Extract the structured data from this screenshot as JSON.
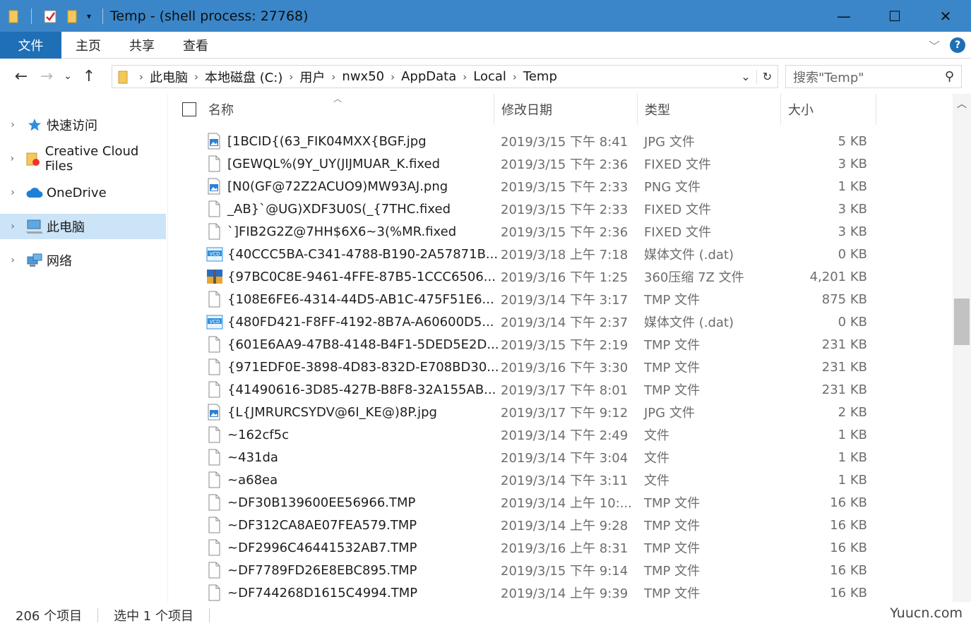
{
  "window": {
    "title": "Temp - (shell process: 27768)",
    "minimize": "—",
    "maximize": "☐",
    "close": "✕"
  },
  "ribbon": {
    "tabs": [
      "文件",
      "主页",
      "共享",
      "查看"
    ]
  },
  "address": {
    "crumbs": [
      "此电脑",
      "本地磁盘 (C:)",
      "用户",
      "nwx50",
      "AppData",
      "Local",
      "Temp"
    ],
    "search_placeholder": "搜索\"Temp\""
  },
  "sidebar": {
    "items": [
      {
        "label": "快速访问",
        "icon": "star-icon"
      },
      {
        "label": "Creative Cloud Files",
        "icon": "folder-cc-icon"
      },
      {
        "label": "OneDrive",
        "icon": "cloud-icon"
      },
      {
        "label": "此电脑",
        "icon": "computer-icon",
        "selected": true
      },
      {
        "label": "网络",
        "icon": "network-icon"
      }
    ]
  },
  "columns": {
    "name": "名称",
    "date": "修改日期",
    "type": "类型",
    "size": "大小"
  },
  "files": [
    {
      "name": "[1BCID{(63_FIK04MXX{BGF.jpg",
      "date": "2019/3/15 下午 8:41",
      "type": "JPG 文件",
      "size": "5 KB",
      "icon": "image"
    },
    {
      "name": "[GEWQL%(9Y_UY(JIJMUAR_K.fixed",
      "date": "2019/3/15 下午 2:36",
      "type": "FIXED 文件",
      "size": "3 KB",
      "icon": "file"
    },
    {
      "name": "[N0(GF@72Z2ACUO9)MW93AJ.png",
      "date": "2019/3/15 下午 2:33",
      "type": "PNG 文件",
      "size": "1 KB",
      "icon": "image"
    },
    {
      "name": "_AB}`@UG)XDF3U0S(_{7THC.fixed",
      "date": "2019/3/15 下午 2:33",
      "type": "FIXED 文件",
      "size": "3 KB",
      "icon": "file"
    },
    {
      "name": "`]FIB2G2Z@7HH$6X6~3(%MR.fixed",
      "date": "2019/3/15 下午 2:36",
      "type": "FIXED 文件",
      "size": "3 KB",
      "icon": "file"
    },
    {
      "name": "{40CCC5BA-C341-4788-B190-2A57871B...",
      "date": "2019/3/18 上午 7:18",
      "type": "媒体文件 (.dat)",
      "size": "0 KB",
      "icon": "vcd"
    },
    {
      "name": "{97BC0C8E-9461-4FFE-87B5-1CCC6506...",
      "date": "2019/3/16 下午 1:25",
      "type": "360压缩 7Z 文件",
      "size": "4,201 KB",
      "icon": "archive"
    },
    {
      "name": "{108E6FE6-4314-44D5-AB1C-475F51E6...",
      "date": "2019/3/14 下午 3:17",
      "type": "TMP 文件",
      "size": "875 KB",
      "icon": "file"
    },
    {
      "name": "{480FD421-F8FF-4192-8B7A-A60600D5...",
      "date": "2019/3/14 下午 2:37",
      "type": "媒体文件 (.dat)",
      "size": "0 KB",
      "icon": "vcd"
    },
    {
      "name": "{601E6AA9-47B8-4148-B4F1-5DED5E2D...",
      "date": "2019/3/15 下午 2:19",
      "type": "TMP 文件",
      "size": "231 KB",
      "icon": "file"
    },
    {
      "name": "{971EDF0E-3898-4D83-832D-E708BD30...",
      "date": "2019/3/16 下午 3:30",
      "type": "TMP 文件",
      "size": "231 KB",
      "icon": "file"
    },
    {
      "name": "{41490616-3D85-427B-B8F8-32A155AB...",
      "date": "2019/3/17 下午 8:01",
      "type": "TMP 文件",
      "size": "231 KB",
      "icon": "file"
    },
    {
      "name": "{L{JMRURCSYDV@6I_KE@)8P.jpg",
      "date": "2019/3/17 下午 9:12",
      "type": "JPG 文件",
      "size": "2 KB",
      "icon": "image"
    },
    {
      "name": "~162cf5c",
      "date": "2019/3/14 下午 2:49",
      "type": "文件",
      "size": "1 KB",
      "icon": "file"
    },
    {
      "name": "~431da",
      "date": "2019/3/14 下午 3:04",
      "type": "文件",
      "size": "1 KB",
      "icon": "file"
    },
    {
      "name": "~a68ea",
      "date": "2019/3/14 下午 3:11",
      "type": "文件",
      "size": "1 KB",
      "icon": "file"
    },
    {
      "name": "~DF30B139600EE56966.TMP",
      "date": "2019/3/14 上午 10:...",
      "type": "TMP 文件",
      "size": "16 KB",
      "icon": "file"
    },
    {
      "name": "~DF312CA8AE07FEA579.TMP",
      "date": "2019/3/14 上午 9:28",
      "type": "TMP 文件",
      "size": "16 KB",
      "icon": "file"
    },
    {
      "name": "~DF2996C46441532AB7.TMP",
      "date": "2019/3/16 上午 8:31",
      "type": "TMP 文件",
      "size": "16 KB",
      "icon": "file"
    },
    {
      "name": "~DF7789FD26E8EBC895.TMP",
      "date": "2019/3/15 下午 9:14",
      "type": "TMP 文件",
      "size": "16 KB",
      "icon": "file"
    },
    {
      "name": "~DF744268D1615C4994.TMP",
      "date": "2019/3/14 上午 9:39",
      "type": "TMP 文件",
      "size": "16 KB",
      "icon": "file"
    }
  ],
  "status": {
    "item_count": "206 个项目",
    "selected": "选中 1 个项目"
  },
  "watermark": "Yuucn.com",
  "colors": {
    "titlebar": "#3a86c8",
    "file_tab": "#1f6fb7",
    "selected_nav": "#cce4f7"
  }
}
